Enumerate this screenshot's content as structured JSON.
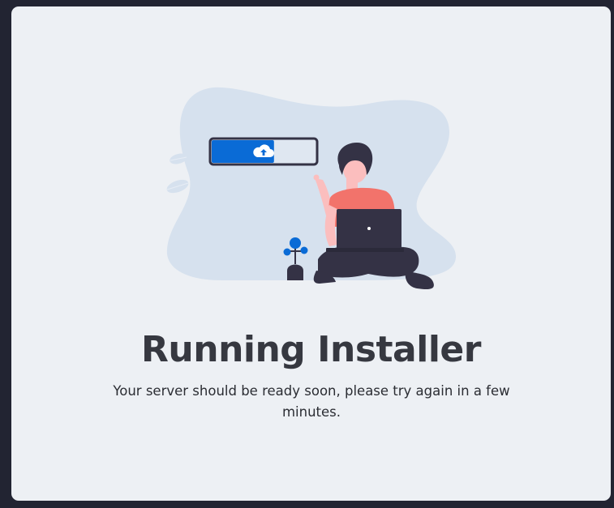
{
  "installer": {
    "title": "Running Installer",
    "message": "Your server should be ready soon, please try again in a few minutes.",
    "progress_fraction": 0.6
  },
  "illustration": {
    "icons": [
      "cloud-upload-icon",
      "leaf-icon",
      "plant-icon",
      "laptop-icon"
    ]
  },
  "colors": {
    "accent": "#0a6bd6",
    "background_panel": "#edf0f4",
    "blob": "#d6e1ee",
    "person_shirt": "#f2736b",
    "dark": "#343245"
  }
}
